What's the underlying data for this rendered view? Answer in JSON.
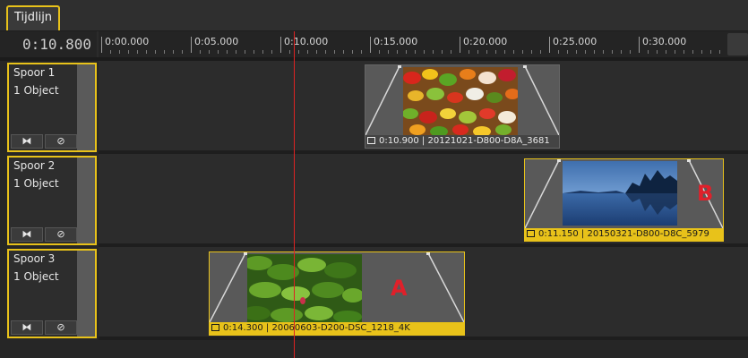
{
  "tab": {
    "label": "Tijdlijn"
  },
  "header": {
    "timecode": "0:10.800"
  },
  "ruler": {
    "labels": [
      "0:00.000",
      "0:05.000",
      "0:10.000",
      "0:15.000",
      "0:20.000",
      "0:25.000",
      "0:30.000"
    ]
  },
  "tracks": [
    {
      "name": "Spoor 1",
      "count": "1 Object",
      "btn_transition": "⧓",
      "btn_disable": "⊘"
    },
    {
      "name": "Spoor 2",
      "count": "1 Object",
      "btn_transition": "⧓",
      "btn_disable": "⊘"
    },
    {
      "name": "Spoor 3",
      "count": "1 Object",
      "btn_transition": "⧓",
      "btn_disable": "⊘"
    }
  ],
  "clips": [
    {
      "duration": "0:10.900",
      "name": "20121021-D800-D8A_3681",
      "selected": false,
      "letter": ""
    },
    {
      "duration": "0:11.150",
      "name": "20150321-D800-D8C_5979",
      "selected": true,
      "letter": "B"
    },
    {
      "duration": "0:14.300",
      "name": "20060603-D200-DSC_1218_4K",
      "selected": true,
      "letter": "A"
    }
  ],
  "playhead": {
    "time": "0:10.800"
  },
  "colors": {
    "accent": "#e8c21a",
    "playhead": "#dd2222",
    "marker": "#e0202a"
  }
}
